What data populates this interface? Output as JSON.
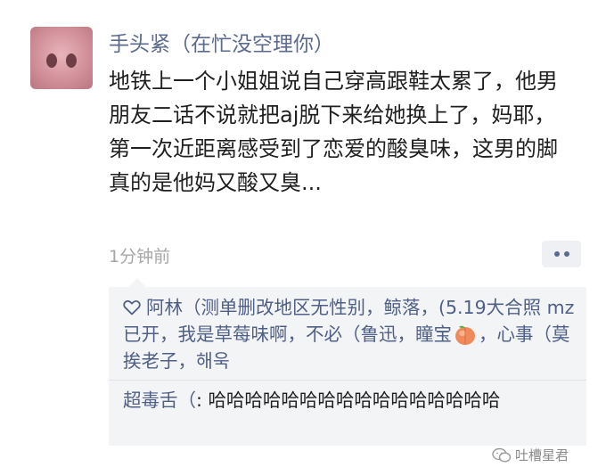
{
  "post": {
    "author": "手头紧（在忙没空理你）",
    "text": "地铁上一个小姐姐说自己穿高跟鞋太累了，他男朋友二话不说就把aj脱下来给她换上了，妈耶，第一次近距离感受到了恋爱的酸臭味，这男的脚真的是他妈又酸又臭...",
    "time": "1分钟前"
  },
  "likes": {
    "part1": "阿林（测单删改地区无性别，鲸落，(5.19大合照 mz已开，我是草莓味啊，不必（鲁迅，瞳宝",
    "part2": "，心事（莫挨老子，해욱"
  },
  "comment": {
    "commenter": "超毒舌（",
    "separator": ": ",
    "text": "哈哈哈哈哈哈哈哈哈哈哈哈哈哈哈哈"
  },
  "watermark": "吐槽星君",
  "icons": {
    "like": "heart-outline-icon",
    "emoji": "peach-emoji-icon",
    "more": "more-dots-icon",
    "watermark": "wechat-logo-icon"
  },
  "colors": {
    "name_blue": "#5b6a8e",
    "time_gray": "#a6a6a6",
    "comment_bg": "#f3f4f6"
  }
}
